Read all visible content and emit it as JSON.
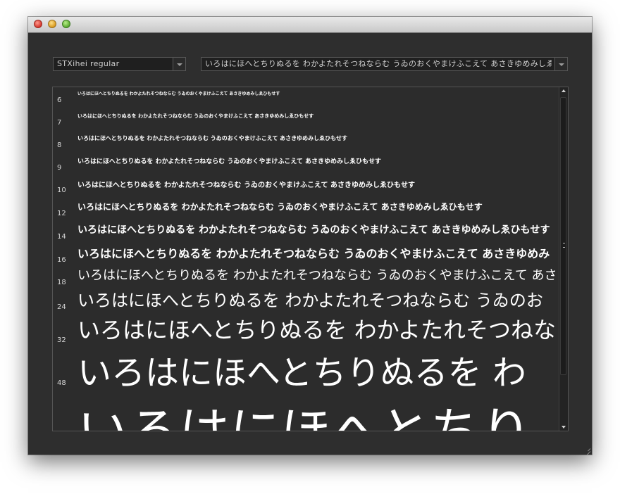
{
  "window": {
    "title": ""
  },
  "font_select": {
    "value": "STXihei regular"
  },
  "sample_select": {
    "value": "いろはにほへとちりぬるを わかよたれそつねならむ うゐのおくやまけふこえて あさきゆめみしゑひもせす"
  },
  "preview": {
    "rows": [
      {
        "size": "6",
        "text": "いろはにほへとちりぬるを わかよたれそつねならむ うゐのおくやまけふこえて あさきゆめみしゑひもせす"
      },
      {
        "size": "7",
        "text": "いろはにほへとちりぬるを わかよたれそつねならむ うゐのおくやまけふこえて あさきゆめみしゑひもせす"
      },
      {
        "size": "8",
        "text": "いろはにほへとちりぬるを わかよたれそつねならむ うゐのおくやまけふこえて あさきゆめみしゑひもせす"
      },
      {
        "size": "9",
        "text": "いろはにほへとちりぬるを わかよたれそつねならむ うゐのおくやまけふこえて あさきゆめみしゑひもせす"
      },
      {
        "size": "10",
        "text": "いろはにほへとちりぬるを わかよたれそつねならむ うゐのおくやまけふこえて あさきゆめみしゑひもせす"
      },
      {
        "size": "12",
        "text": "いろはにほへとちりぬるを わかよたれそつねならむ うゐのおくやまけふこえて あさきゆめみしゑひもせす"
      },
      {
        "size": "14",
        "text": "いろはにほへとちりぬるを わかよたれそつねならむ うゐのおくやまけふこえて あさきゆめみしゑひもせす"
      },
      {
        "size": "16",
        "text": "いろはにほへとちりぬるを わかよたれそつねならむ うゐのおくやまけふこえて あさきゆめみ"
      },
      {
        "size": "18",
        "text": "いろはにほへとちりぬるを わかよたれそつねならむ うゐのおくやまけふこえて あさ"
      },
      {
        "size": "24",
        "text": "いろはにほへとちりぬるを わかよたれそつねならむ うゐのお"
      },
      {
        "size": "32",
        "text": "いろはにほへとちりぬるを わかよたれそつねな"
      },
      {
        "size": "48",
        "text": "いろはにほへとちりぬるを わ"
      },
      {
        "size": "",
        "text": "いろはにほへとちり"
      }
    ]
  }
}
